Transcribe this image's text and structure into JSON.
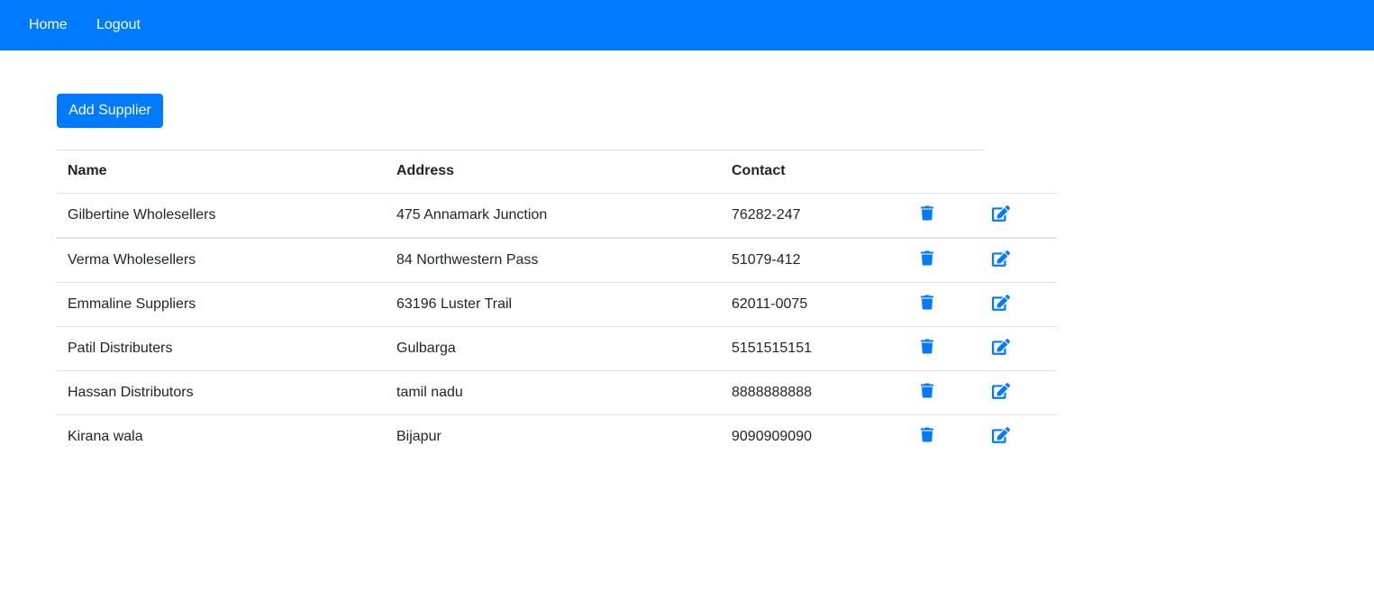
{
  "nav": {
    "home_label": "Home",
    "logout_label": "Logout"
  },
  "add_button_label": "Add Supplier",
  "table": {
    "headers": [
      "Name",
      "Address",
      "Contact"
    ],
    "rows": [
      {
        "name": "Gilbertine Wholesellers",
        "address": "475 Annamark Junction",
        "contact": "76282-247"
      },
      {
        "name": "Verma Wholesellers",
        "address": "84 Northwestern Pass",
        "contact": "51079-412"
      },
      {
        "name": "Emmaline Suppliers",
        "address": "63196 Luster Trail",
        "contact": "62011-0075"
      },
      {
        "name": "Patil Distributers",
        "address": "Gulbarga",
        "contact": "5151515151"
      },
      {
        "name": "Hassan Distributors",
        "address": "tamil nadu",
        "contact": "8888888888"
      },
      {
        "name": "Kirana wala",
        "address": "Bijapur",
        "contact": "9090909090"
      }
    ],
    "row_icons": {
      "delete": "trash-icon",
      "edit": "edit-icon"
    }
  },
  "colors": {
    "primary": "#007bff",
    "border": "#dee2e6",
    "text": "#212529"
  }
}
